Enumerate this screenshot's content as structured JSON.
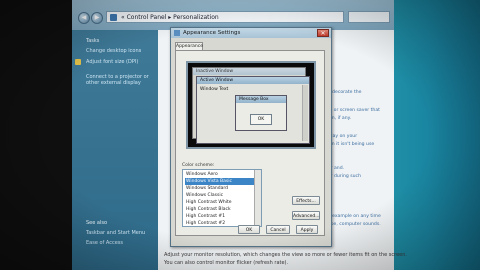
{
  "address_bar": {
    "path": "« Control Panel  ▸  Personalization"
  },
  "task_pane": {
    "title": "Tasks",
    "links": [
      "Change desktop icons",
      "Adjust font size (DPI)"
    ],
    "desc": "Connect to a projector or other external display",
    "see_also_title": "See also",
    "see_also": [
      "Taskbar and Start Menu",
      "Ease of Access"
    ]
  },
  "content": {
    "fragments": [
      "to decorate the",
      "er, or screen saver that",
      "hen, if any.",
      "splay on your",
      "hen it isn't being use",
      "ter and.",
      "ter during such",
      "ry example on any time",
      "tape, computer sounds."
    ],
    "bottom_lines": [
      "Adjust your monitor resolution, which changes the view so more or fewer items fit on the screen.",
      "You can also control monitor flicker (refresh rate)."
    ]
  },
  "dialog": {
    "title": "Appearance Settings",
    "tab": "Appearance",
    "preview": {
      "inactive_title": "Inactive Window",
      "active_title": "Active Window",
      "window_text": "Window Text",
      "message_title": "Message Box",
      "ok_label": "OK"
    },
    "color_scheme_label": "Color scheme:",
    "schemes": [
      "Windows Aero",
      "Windows Vista Basic",
      "Windows Standard",
      "Windows Classic",
      "High Contrast White",
      "High Contrast Black",
      "High Contrast #1",
      "High Contrast #2"
    ],
    "selected_scheme_index": 1,
    "effects_label": "Effects...",
    "advanced_label": "Advanced...",
    "ok_label": "OK",
    "cancel_label": "Cancel",
    "apply_label": "Apply"
  }
}
